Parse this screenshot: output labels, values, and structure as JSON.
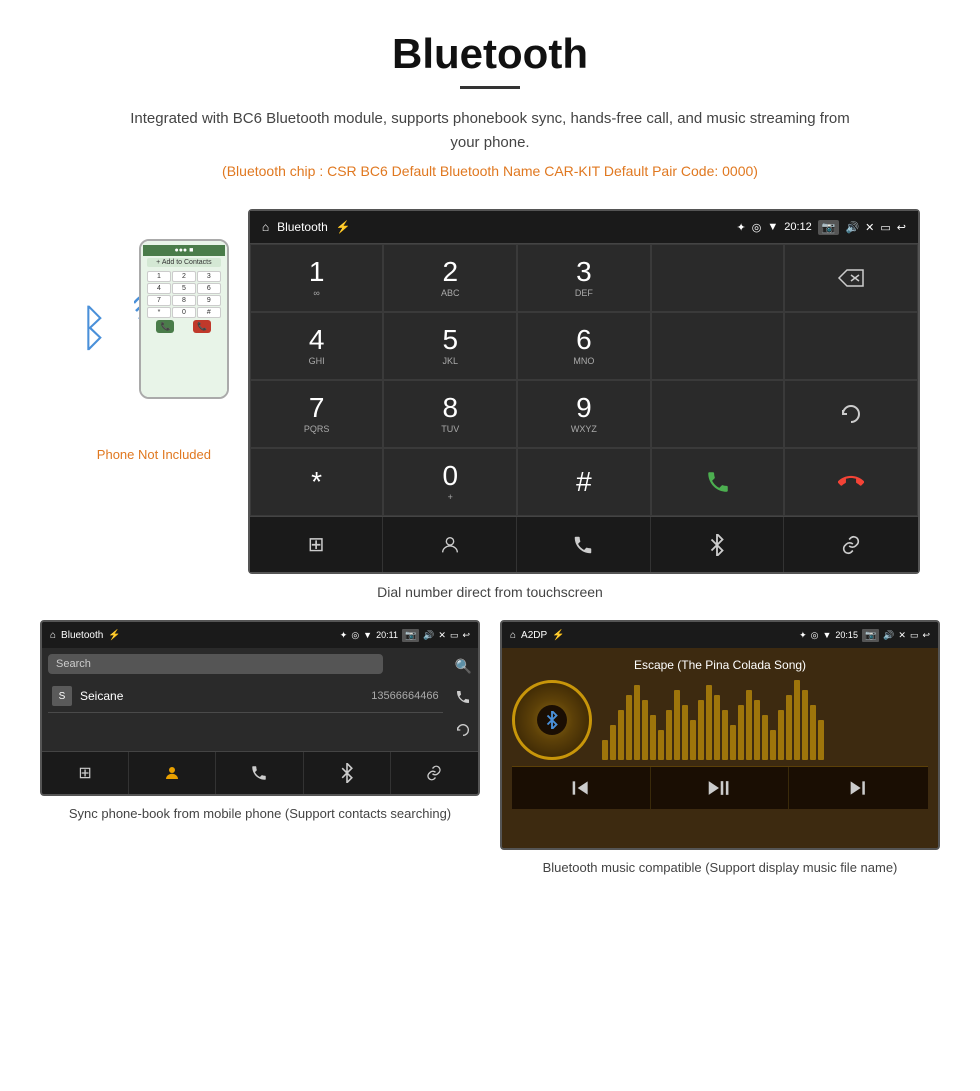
{
  "page": {
    "title": "Bluetooth",
    "description": "Integrated with BC6 Bluetooth module, supports phonebook sync, hands-free call, and music streaming from your phone.",
    "specs": "(Bluetooth chip : CSR BC6    Default Bluetooth Name CAR-KIT    Default Pair Code: 0000)",
    "dial_caption": "Dial number direct from touchscreen",
    "phonebook_caption": "Sync phone-book from mobile phone\n(Support contacts searching)",
    "music_caption": "Bluetooth music compatible\n(Support display music file name)"
  },
  "statusbar_main": {
    "home": "⌂",
    "title": "Bluetooth",
    "usb": "⚡",
    "bt": "✦",
    "location": "◎",
    "wifi": "▼",
    "time": "20:12",
    "camera_icon": "📷",
    "volume": "🔊",
    "close": "✕",
    "rect": "▭",
    "back": "↩"
  },
  "dialpad": {
    "keys": [
      {
        "num": "1",
        "sub": "∞"
      },
      {
        "num": "2",
        "sub": "ABC"
      },
      {
        "num": "3",
        "sub": "DEF"
      },
      {
        "num": "",
        "sub": ""
      },
      {
        "num": "",
        "sub": "",
        "icon": "⌫"
      },
      {
        "num": "4",
        "sub": "GHI"
      },
      {
        "num": "5",
        "sub": "JKL"
      },
      {
        "num": "6",
        "sub": "MNO"
      },
      {
        "num": "",
        "sub": ""
      },
      {
        "num": "",
        "sub": ""
      },
      {
        "num": "7",
        "sub": "PQRS"
      },
      {
        "num": "8",
        "sub": "TUV"
      },
      {
        "num": "9",
        "sub": "WXYZ"
      },
      {
        "num": "",
        "sub": ""
      },
      {
        "num": "",
        "sub": "",
        "icon": "↻"
      },
      {
        "num": "*",
        "sub": ""
      },
      {
        "num": "0",
        "sub": "+"
      },
      {
        "num": "#",
        "sub": ""
      },
      {
        "num": "",
        "sub": "",
        "icon": "📞",
        "green": true
      },
      {
        "num": "",
        "sub": "",
        "icon": "📞",
        "red": true
      }
    ],
    "toolbar": [
      "⊞",
      "👤",
      "📞",
      "✦",
      "🔗"
    ]
  },
  "phonebook": {
    "statusbar_title": "Bluetooth",
    "statusbar_time": "20:11",
    "search_placeholder": "Search",
    "contacts": [
      {
        "letter": "S",
        "name": "Seicane",
        "number": "13566664466"
      }
    ],
    "side_icons": [
      "🔍",
      "📞",
      "↻"
    ],
    "toolbar": [
      "⊞",
      "👤",
      "📞",
      "✦",
      "🔗"
    ]
  },
  "music": {
    "statusbar_title": "A2DP",
    "statusbar_time": "20:15",
    "song_title": "Escape (The Pina Colada Song)",
    "waveform_heights": [
      20,
      35,
      50,
      65,
      80,
      70,
      55,
      40,
      30,
      50,
      70,
      85,
      75,
      60,
      45,
      30,
      50,
      65,
      80,
      70
    ],
    "controls": [
      "⏮",
      "▶⏸",
      "⏭"
    ]
  },
  "phone_not_included": "Phone Not Included"
}
